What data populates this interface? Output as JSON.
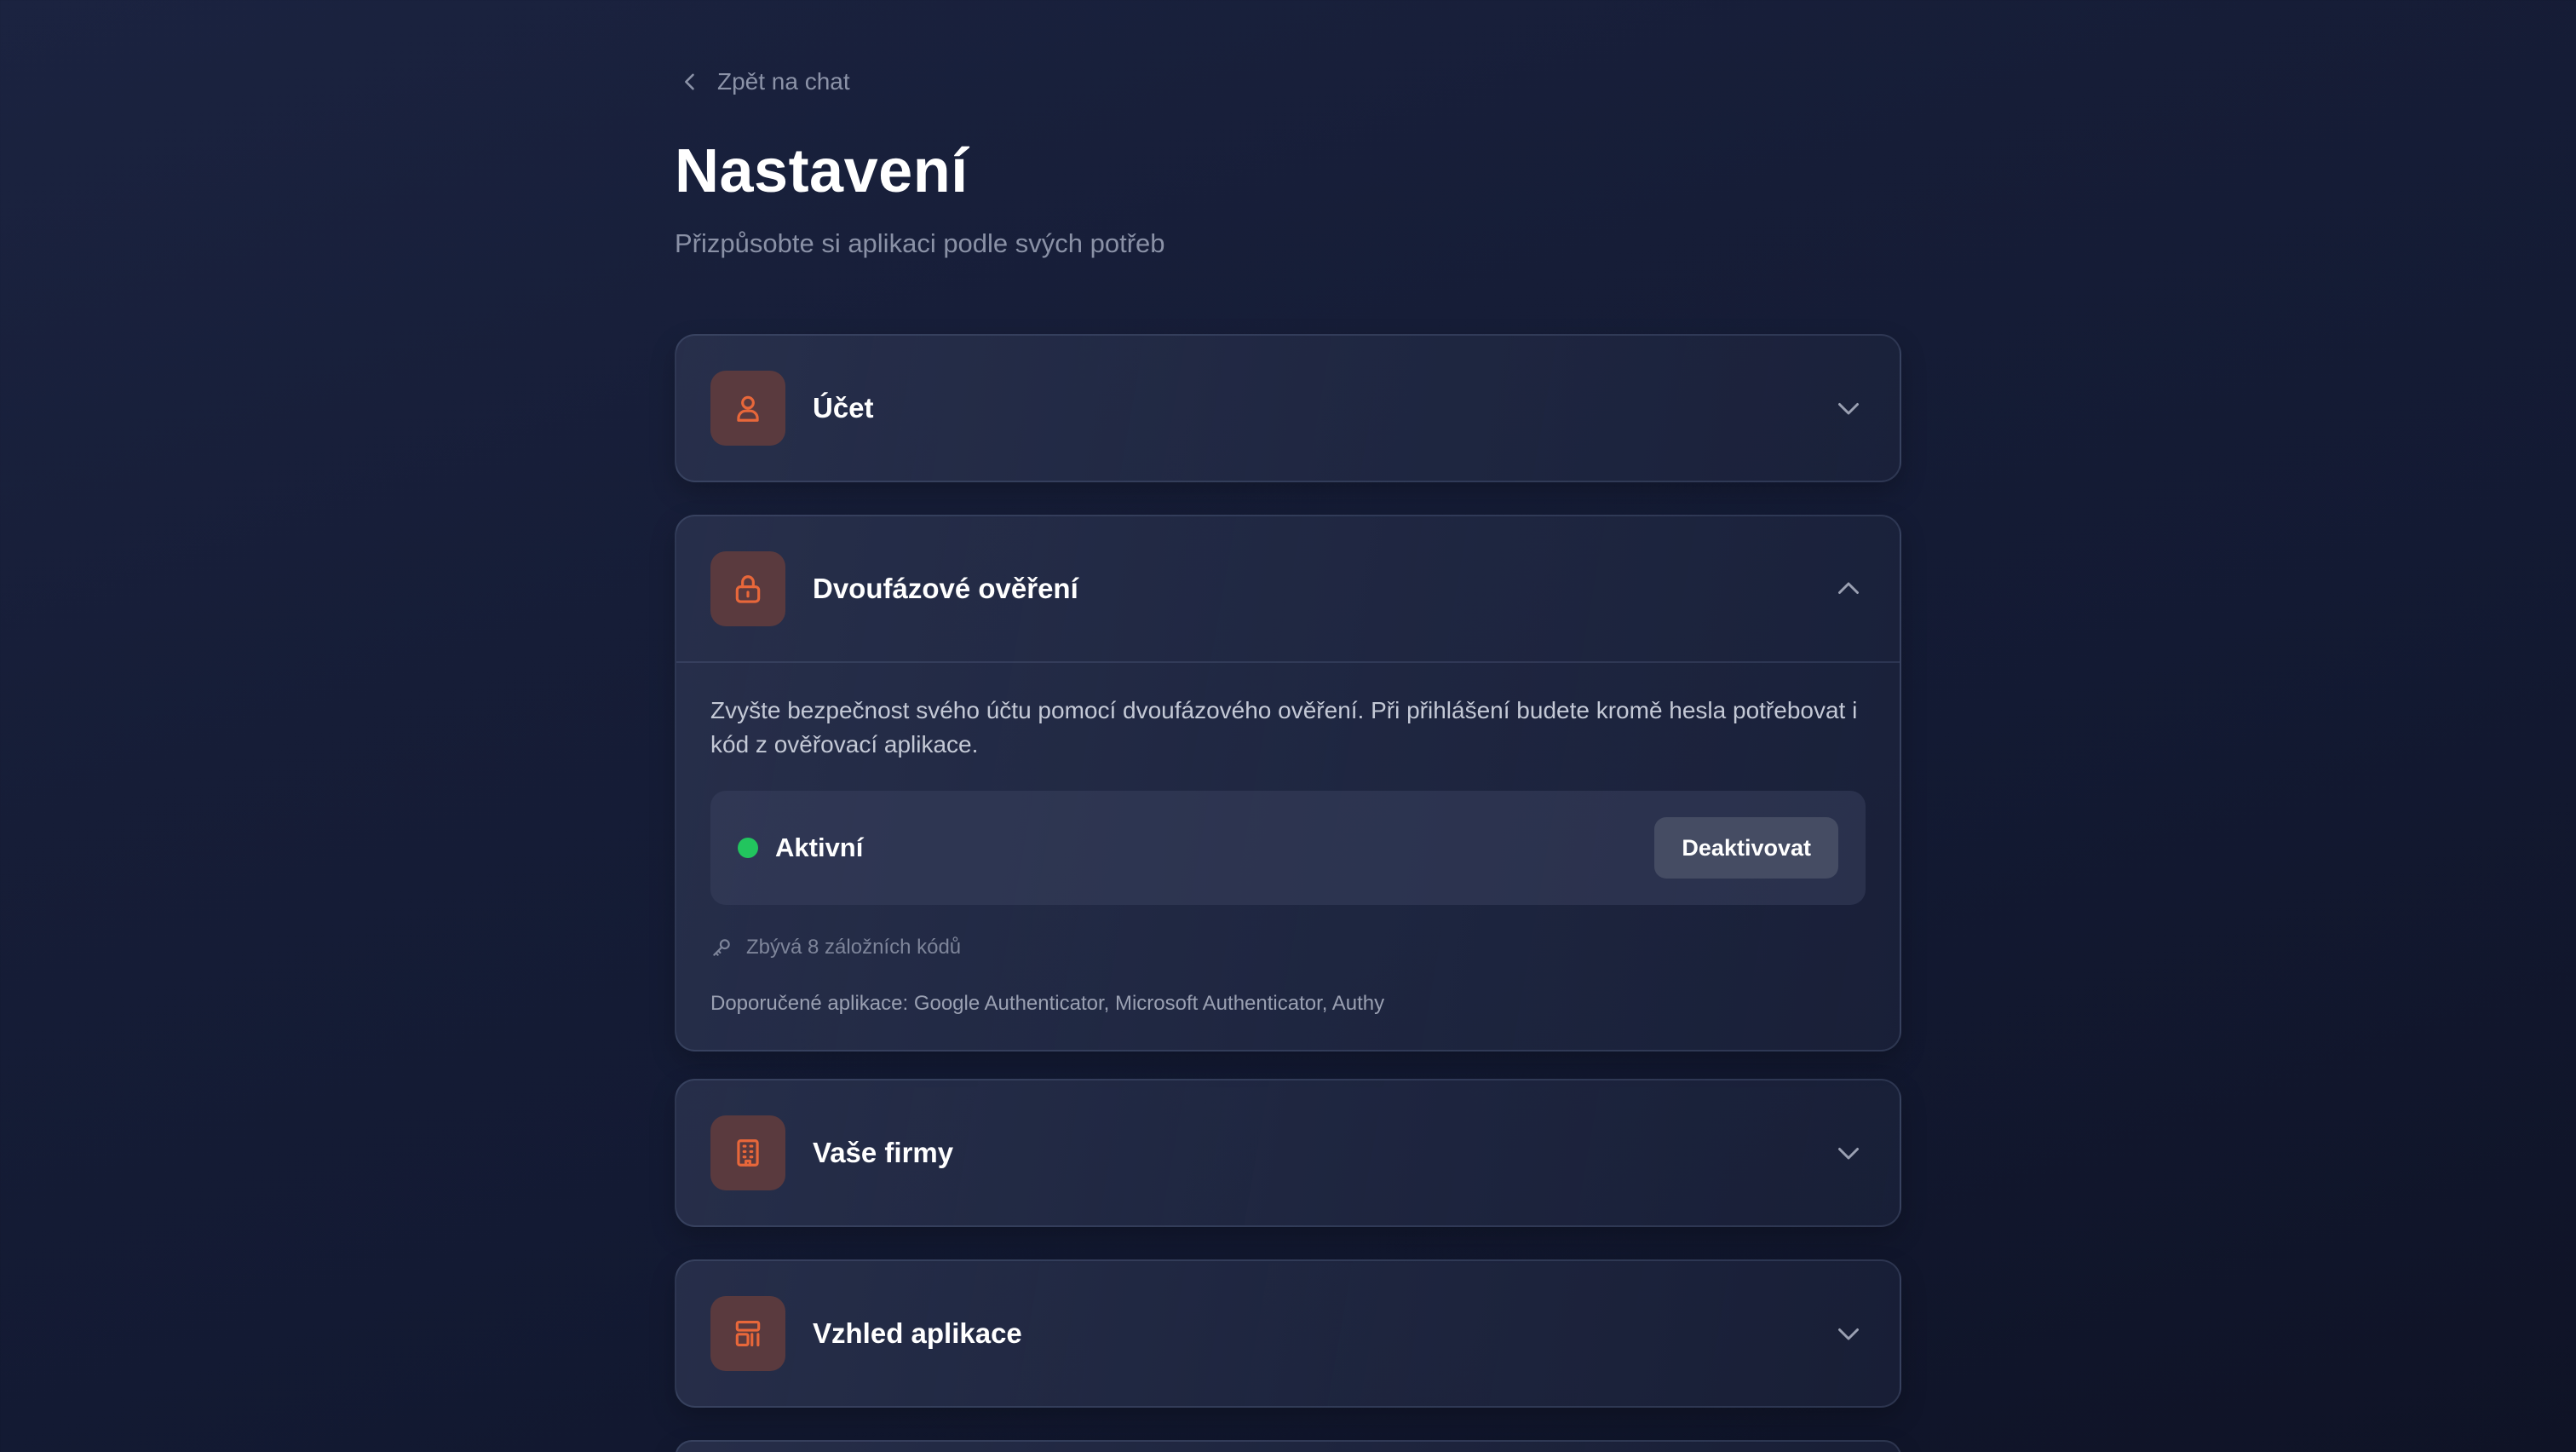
{
  "back_link": {
    "label": "Zpět na chat",
    "icon": "chevron-left-icon"
  },
  "header": {
    "title": "Nastavení",
    "subtitle": "Přizpůsobte si aplikaci podle svých potřeb"
  },
  "sections": [
    {
      "title": "Účet",
      "icon": "user-icon",
      "expanded": false
    },
    {
      "title": "Dvoufázové ověření",
      "icon": "lock-icon",
      "expanded": true,
      "description": "Zvyšte bezpečnost svého účtu pomocí dvoufázového ověření. Při přihlášení budete kromě hesla potřebovat i kód z ověřovací aplikace.",
      "status_label": "Aktivní",
      "status_color": "#22c55e",
      "deactivate_label": "Deaktivovat",
      "backup_codes_text": "Zbývá 8 záložních kódů",
      "recommended_apps_text": "Doporučené aplikace: Google Authenticator, Microsoft Authenticator, Authy"
    },
    {
      "title": "Vaše firmy",
      "icon": "building-icon",
      "expanded": false
    },
    {
      "title": "Vzhled aplikace",
      "icon": "layout-icon",
      "expanded": false
    }
  ],
  "colors": {
    "accent": "#e8673a",
    "icon_bg": "#5a3a3e",
    "background": "#161d37",
    "status_active": "#22c55e"
  }
}
